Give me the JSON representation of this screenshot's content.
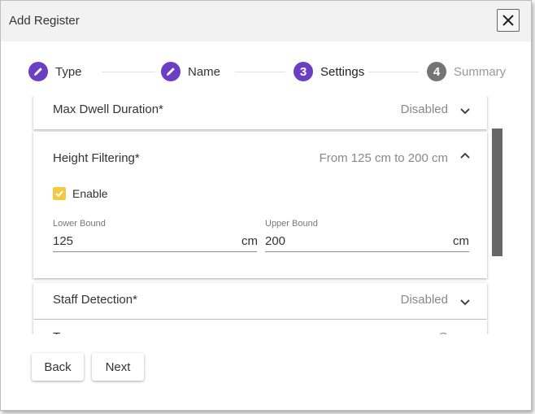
{
  "dialog": {
    "title": "Add Register"
  },
  "colors": {
    "accent": "#6a3fc2",
    "inactive_step": "#757575",
    "checkbox": "#f5c842",
    "scrollbar": "#676767"
  },
  "stepper": {
    "steps": [
      {
        "icon": "pencil-icon",
        "label": "Type",
        "state": "completed"
      },
      {
        "icon": "pencil-icon",
        "label": "Name",
        "state": "completed"
      },
      {
        "number": "3",
        "label": "Settings",
        "state": "active"
      },
      {
        "number": "4",
        "label": "Summary",
        "state": "inactive"
      }
    ]
  },
  "settings": {
    "max_dwell": {
      "title": "Max Dwell Duration*",
      "value": "Disabled",
      "expanded": false
    },
    "height_filtering": {
      "title": "Height Filtering*",
      "value": "From 125 cm to 200 cm",
      "expanded": true,
      "enable_label": "Enable",
      "enabled": true,
      "lower": {
        "label": "Lower Bound",
        "value": "125",
        "unit": "cm"
      },
      "upper": {
        "label": "Upper Bound",
        "value": "200",
        "unit": "cm"
      }
    },
    "staff_detection": {
      "title": "Staff Detection*",
      "value": "Disabled",
      "expanded": false
    },
    "next_partial": {
      "title": "T",
      "value": "O"
    }
  },
  "actions": {
    "back_label": "Back",
    "next_label": "Next"
  }
}
